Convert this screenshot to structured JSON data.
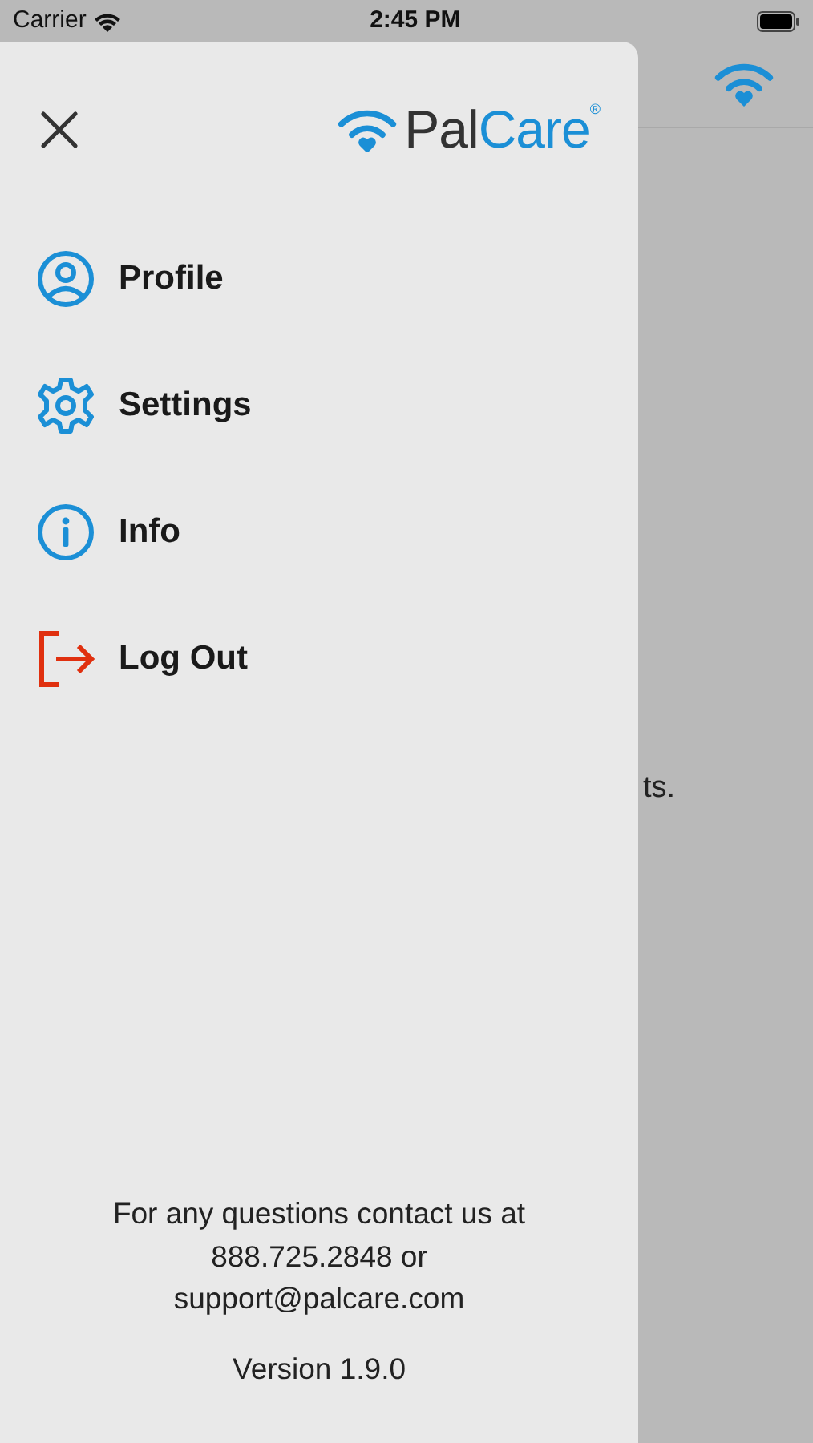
{
  "status_bar": {
    "carrier": "Carrier",
    "time": "2:45 PM"
  },
  "background": {
    "text_fragment": "ts."
  },
  "drawer": {
    "logo": {
      "first": "Pal",
      "second": "Care",
      "mark": "®"
    },
    "menu": [
      {
        "kind": "profile",
        "label": "Profile"
      },
      {
        "kind": "settings",
        "label": "Settings"
      },
      {
        "kind": "info",
        "label": "Info"
      },
      {
        "kind": "logout",
        "label": "Log Out"
      }
    ],
    "contact": "For any questions contact us at 888.725.2848 or support@palcare.com",
    "version": "Version 1.9.0"
  }
}
